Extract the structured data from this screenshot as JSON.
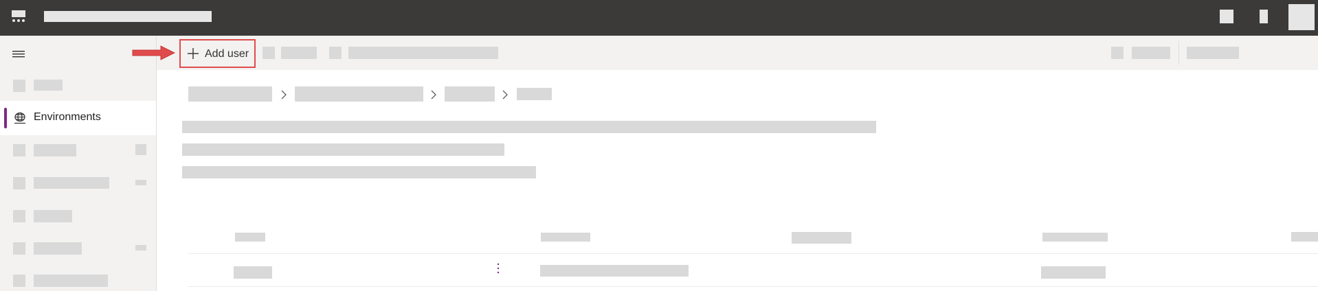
{
  "sidebar": {
    "active_item": {
      "label": "Environments",
      "icon": "globe-icon"
    },
    "menu_icon": "hamburger-icon"
  },
  "toolbar": {
    "add_user_label": "Add user",
    "add_user_icon": "plus-icon"
  },
  "annotation": {
    "arrow_color": "#e04b4b",
    "highlight_color": "#e04b4b"
  },
  "colors": {
    "topbar": "#3b3a39",
    "accent": "#7b2a82"
  }
}
